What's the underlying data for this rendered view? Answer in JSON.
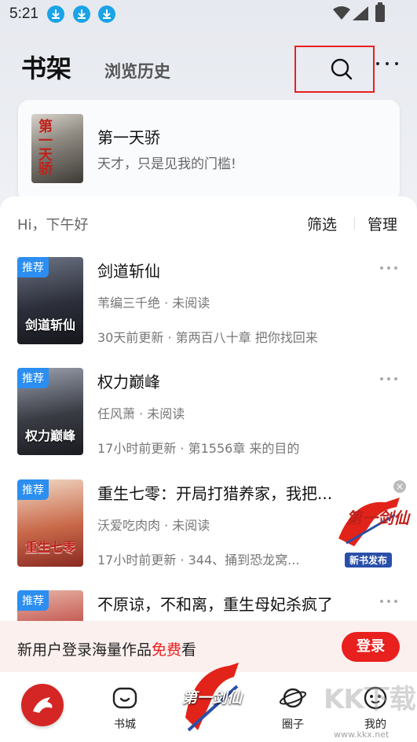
{
  "status_bar": {
    "time": "5:21"
  },
  "header": {
    "title": "书架",
    "tab_history": "浏览历史"
  },
  "feature": {
    "cover_text": "第一天骄",
    "title": "第一天骄",
    "subtitle": "天才，只是见我的门槛!"
  },
  "shelf": {
    "greeting": "Hi，下午好",
    "filter_label": "筛选",
    "manage_label": "管理",
    "books": [
      {
        "badge": "推荐",
        "cover_text": "剑道斩仙",
        "title": "剑道斩仙",
        "meta": "苇编三千绝 · 未阅读",
        "update": "30天前更新 · 第两百八十章  把你找回来",
        "cover_color": "#2c2f3a"
      },
      {
        "badge": "推荐",
        "cover_text": "权力巅峰",
        "title": "权力巅峰",
        "meta": "任风萧 · 未阅读",
        "update": "17小时前更新 · 第1556章 来的目的",
        "cover_color": "#3a3c44"
      },
      {
        "badge": "推荐",
        "cover_text": "重生七零",
        "title": "重生七零：开局打猎养家，我把...",
        "meta": "沃爱吃肉肉 · 未阅读",
        "update": "17小时前更新 · 344、捅到恐龙窝...",
        "cover_color": "#c9694a"
      },
      {
        "badge": "推荐",
        "cover_text": "",
        "title": "不原谅，不和离，重生母妃杀疯了",
        "meta": "",
        "update": "",
        "cover_color": "#b83a36"
      }
    ]
  },
  "promo": {
    "close": "×",
    "art_text": "第一剑仙",
    "label": "新书发布"
  },
  "login_banner": {
    "text_before": "新用户登录海量作品",
    "text_highlight": "免费",
    "text_after": "看",
    "button": "登录"
  },
  "bottom_nav": {
    "bookstore": "书城",
    "center_art": "第一剑仙",
    "circle": "圈子",
    "mine": "我的"
  },
  "watermark": {
    "text": "KK下载",
    "url": "www.kkx.net"
  },
  "colors": {
    "accent": "#e8201e",
    "badge": "#2b8ef0",
    "download": "#1aa3e8"
  }
}
